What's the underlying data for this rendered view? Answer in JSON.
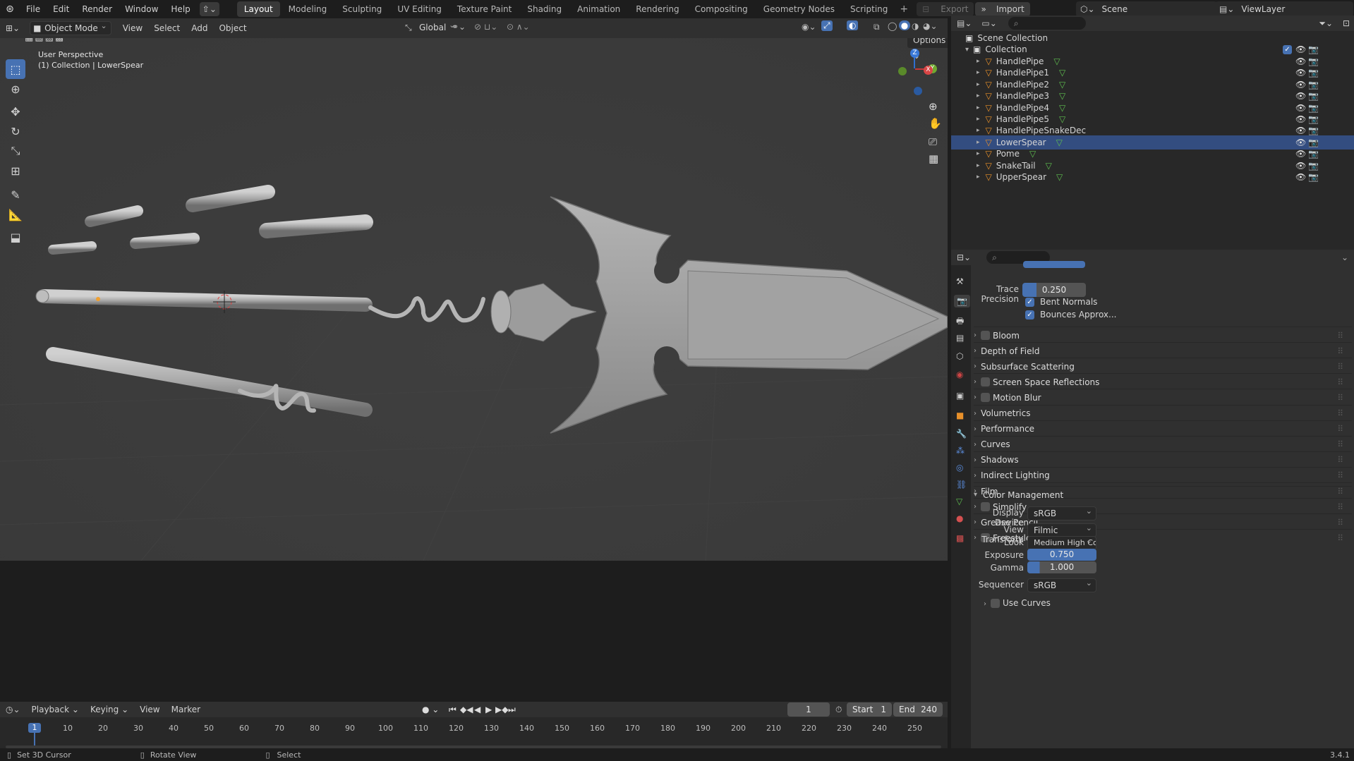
{
  "topbar": {
    "menus": [
      "File",
      "Edit",
      "Render",
      "Window",
      "Help"
    ],
    "workspaces": [
      "Layout",
      "Modeling",
      "Sculpting",
      "UV Editing",
      "Texture Paint",
      "Shading",
      "Animation",
      "Rendering",
      "Compositing",
      "Geometry Nodes",
      "Scripting"
    ],
    "active_workspace": "Layout",
    "export_label": "Export",
    "import_label": "Import",
    "scene_name": "Scene",
    "view_layer": "ViewLayer"
  },
  "viewport_header": {
    "mode": "Object Mode",
    "menus": [
      "View",
      "Select",
      "Add",
      "Object"
    ],
    "transform_orientation": "Global",
    "options_label": "Options"
  },
  "viewport": {
    "perspective_label": "User Perspective",
    "collection_label": "(1) Collection | LowerSpear",
    "axes": {
      "z": "Z",
      "y": "Y",
      "x": "X"
    }
  },
  "outliner": {
    "scene_collection": "Scene Collection",
    "collection": "Collection",
    "objects": [
      "HandlePipe",
      "HandlePipe1",
      "HandlePipe2",
      "HandlePipe3",
      "HandlePipe4",
      "HandlePipe5",
      "HandlePipeSnakeDec",
      "LowerSpear",
      "Pome",
      "SnakeTail",
      "UpperSpear"
    ],
    "selected": "LowerSpear"
  },
  "properties": {
    "trace_precision_label": "Trace Precision",
    "trace_precision": "0.250",
    "bent_normals": "Bent Normals",
    "bounces_approx": "Bounces Approx...",
    "panels": [
      "Bloom",
      "Depth of Field",
      "Subsurface Scattering",
      "Screen Space Reflections",
      "Motion Blur",
      "Volumetrics",
      "Performance",
      "Curves",
      "Shadows",
      "Indirect Lighting",
      "Film",
      "Simplify",
      "Grease Pencil",
      "Freestyle"
    ],
    "panels_with_checkbox": [
      "Bloom",
      "Screen Space Reflections",
      "Motion Blur",
      "Simplify",
      "Freestyle"
    ],
    "color_management": "Color Management",
    "display_device_label": "Display Device",
    "display_device": "sRGB",
    "view_transform_label": "View Transform",
    "view_transform": "Filmic",
    "look_label": "Look",
    "look": "Medium High Cont...",
    "exposure_label": "Exposure",
    "exposure": "0.750",
    "gamma_label": "Gamma",
    "gamma": "1.000",
    "sequencer_label": "Sequencer",
    "sequencer": "sRGB",
    "use_curves": "Use Curves"
  },
  "timeline": {
    "menus": [
      "Playback",
      "Keying",
      "View",
      "Marker"
    ],
    "current_frame": "1",
    "start_label": "Start",
    "start": "1",
    "end_label": "End",
    "end": "240",
    "ticks": [
      "1",
      "10",
      "20",
      "30",
      "40",
      "50",
      "60",
      "70",
      "80",
      "90",
      "100",
      "110",
      "120",
      "130",
      "140",
      "150",
      "160",
      "170",
      "180",
      "190",
      "200",
      "210",
      "220",
      "230",
      "240",
      "250"
    ]
  },
  "statusbar": {
    "hint1": "Set 3D Cursor",
    "hint2": "Rotate View",
    "hint3": "Select",
    "version": "3.4.1"
  },
  "colors": {
    "accent": "#4772b3",
    "viewport": "#3d3d3d",
    "panel": "#303030"
  }
}
